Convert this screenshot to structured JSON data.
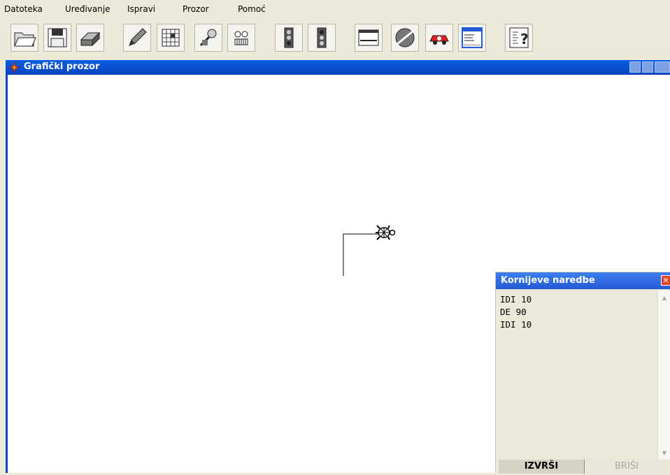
{
  "menu": [
    "Datoteka",
    "Uređivanje",
    "Ispravi",
    "Prozor",
    "Pomoć"
  ],
  "toolbar": {
    "buttons": [
      {
        "name": "open-folder-icon"
      },
      {
        "name": "save-disk-icon"
      },
      {
        "name": "print-icon"
      },
      {
        "name": "pencil-icon"
      },
      {
        "name": "grid-palette-icon"
      },
      {
        "name": "tools-icon"
      },
      {
        "name": "turtle-face-icon"
      },
      {
        "name": "traffic-light-icon"
      },
      {
        "name": "traffic-light-alt-icon"
      },
      {
        "name": "window-icon"
      },
      {
        "name": "disc-icon"
      },
      {
        "name": "car-icon"
      },
      {
        "name": "command-window-icon"
      },
      {
        "name": "help-icon"
      }
    ]
  },
  "graphic_window": {
    "title": "Grafički prozor",
    "accent": "#0844c0"
  },
  "command_window": {
    "title": "Kornijeve naredbe",
    "commands": [
      "IDI 10",
      "DE 90",
      "IDI 10"
    ],
    "run_label": "IZVRŠI",
    "clear_label": "BRIŠI"
  }
}
